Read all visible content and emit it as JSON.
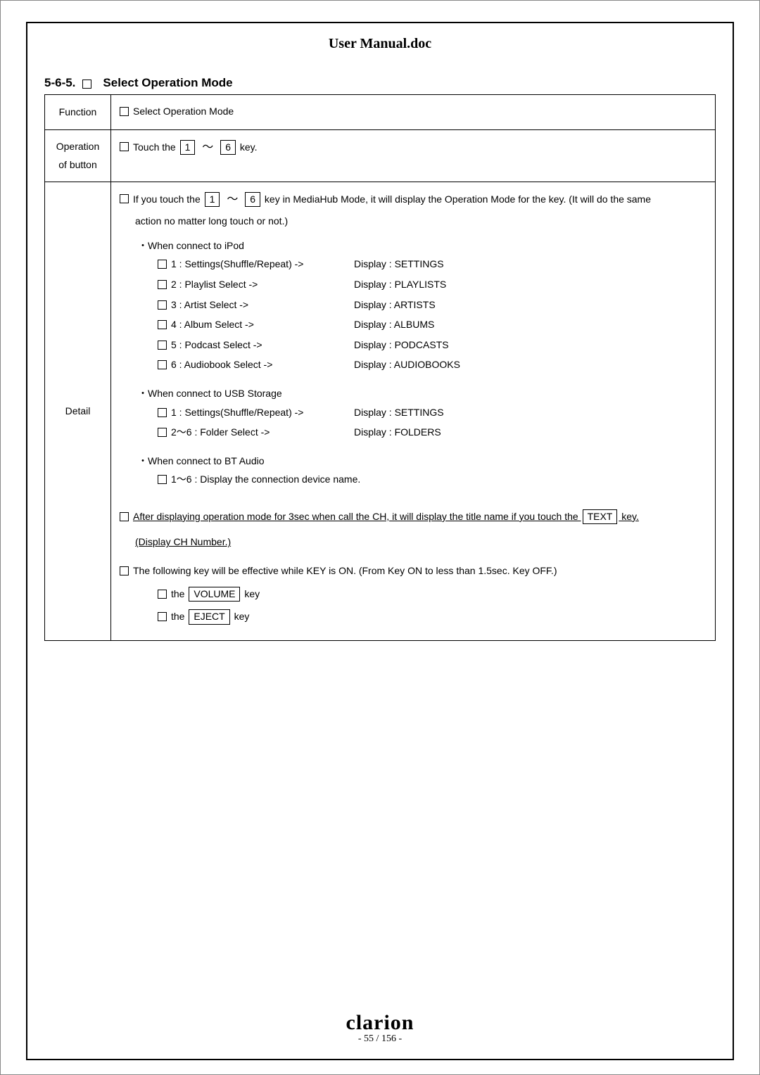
{
  "doc_title": "User Manual.doc",
  "section_number": "5-6-5.",
  "section_title": "Select Operation Mode",
  "rows": {
    "function_label": "Function",
    "function_text": "Select Operation Mode",
    "operation_label_1": "Operation",
    "operation_label_2": "of button",
    "operation_text_pre": "Touch the ",
    "operation_key1": "1",
    "operation_key2": "6",
    "operation_text_post": " key.",
    "detail_label": "Detail",
    "detail": {
      "intro_pre": "If you touch the",
      "intro_key1": "1",
      "intro_key2": "6",
      "intro_mid": " key in MediaHub Mode, it will display the Operation Mode for the key. (It will do the same",
      "intro_line2": "action no matter long touch or not.)",
      "ipod_header": "・When connect to iPod",
      "ipod_items": [
        {
          "l": "1 : Settings(Shuffle/Repeat) ->",
          "r": "Display  :  SETTINGS"
        },
        {
          "l": "2 : Playlist Select ->",
          "r": "Display  :  PLAYLISTS"
        },
        {
          "l": "3 : Artist Select ->",
          "r": "Display  :  ARTISTS"
        },
        {
          "l": "4 : Album Select ->",
          "r": "Display  :  ALBUMS"
        },
        {
          "l": "5 : Podcast Select ->",
          "r": "Display  :  PODCASTS"
        },
        {
          "l": "6 : Audiobook Select ->",
          "r": "Display  :  AUDIOBOOKS"
        }
      ],
      "usb_header": "・When connect to USB Storage",
      "usb_items": [
        {
          "l": "1 : Settings(Shuffle/Repeat) ->",
          "r": "Display  :  SETTINGS"
        },
        {
          "l": "2～6 : Folder Select ->",
          "r": "Display  :  FOLDERS"
        }
      ],
      "bt_header": "・When connect to BT Audio",
      "bt_item": "1～6 : Display the connection device name.",
      "after_text_pre": " After displaying operation mode for 3sec when call the CH, it will display the title name if you touch the ",
      "after_key": "TEXT",
      "after_text_post": " key.",
      "display_line": "(Display CH Number.)",
      "effective_text": "The following key will be effective while KEY is ON. (From Key ON to less than 1.5sec.   Key OFF.)",
      "vol_pre": "the ",
      "vol_key": "VOLUME",
      "vol_post": " key",
      "eject_pre": "the ",
      "eject_key": "EJECT",
      "eject_post": " key"
    }
  },
  "footer": {
    "brand": "clarion",
    "page": "- 55 / 156 -"
  }
}
